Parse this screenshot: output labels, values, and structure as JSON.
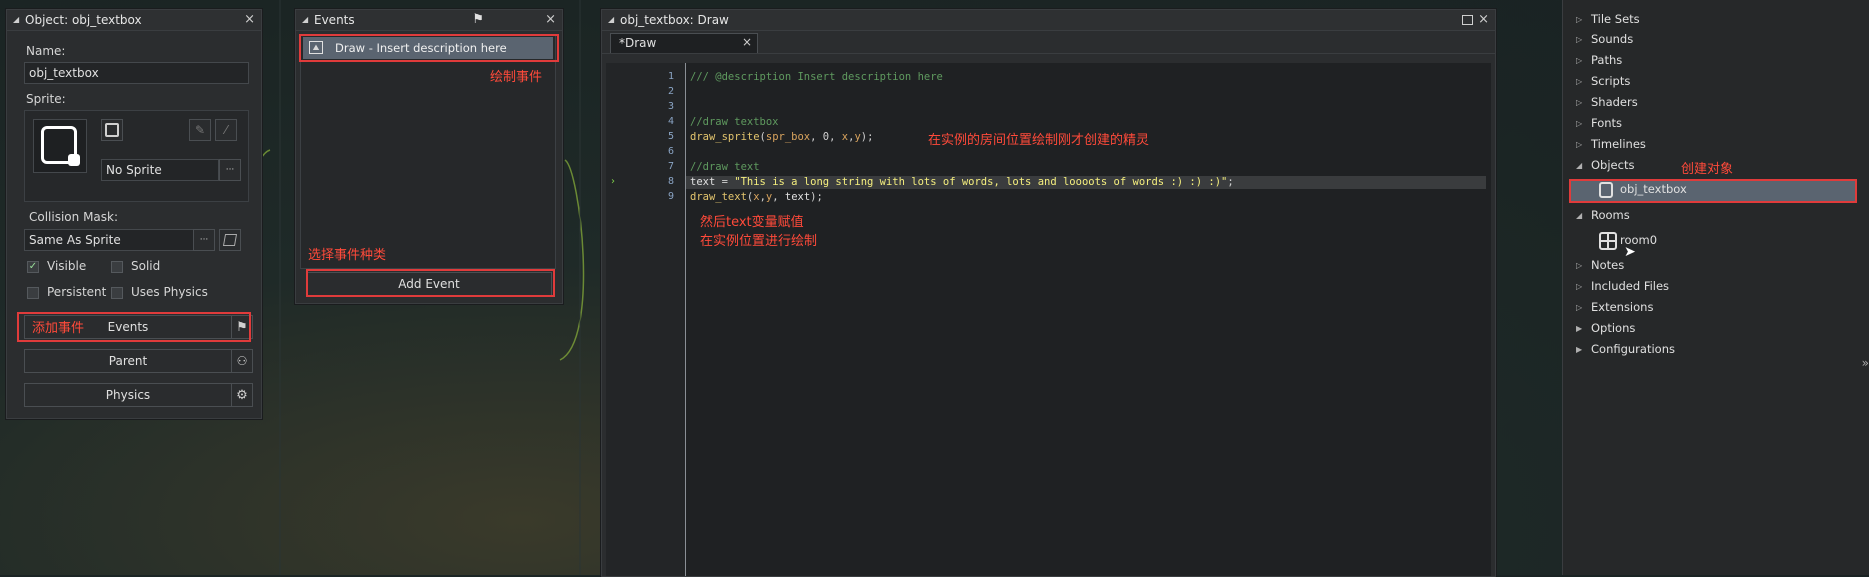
{
  "object_panel": {
    "title": "Object: obj_textbox",
    "name_label": "Name:",
    "name_value": "obj_textbox",
    "sprite_label": "Sprite:",
    "sprite_value": "No Sprite",
    "collision_label": "Collision Mask:",
    "collision_value": "Same As Sprite",
    "visible_label": "Visible",
    "solid_label": "Solid",
    "persistent_label": "Persistent",
    "physics_check_label": "Uses Physics",
    "events_button": "Events",
    "parent_button": "Parent",
    "physics_button": "Physics",
    "ellipsis": "···",
    "visible_checked": true,
    "solid_checked": false,
    "persistent_checked": false,
    "uses_physics_checked": false
  },
  "events_panel": {
    "title": "Events",
    "event_item": "Draw - Insert description here",
    "add_event_button": "Add Event"
  },
  "editor_panel": {
    "title": "obj_textbox: Draw",
    "tab_label": "*Draw",
    "lines": [
      {
        "num": "1",
        "parts": [
          {
            "t": "/// @description Insert description here",
            "c": "#5f9a5f"
          }
        ]
      },
      {
        "num": "2",
        "parts": []
      },
      {
        "num": "3",
        "parts": []
      },
      {
        "num": "4",
        "parts": [
          {
            "t": "//draw textbox",
            "c": "#5f9a5f"
          }
        ]
      },
      {
        "num": "5",
        "parts": [
          {
            "t": "draw_sprite",
            "c": "#e3c56e"
          },
          {
            "t": "(",
            "c": "#d0d0d0"
          },
          {
            "t": "spr_box",
            "c": "#d9a45e"
          },
          {
            "t": ", ",
            "c": "#d0d0d0"
          },
          {
            "t": "0",
            "c": "#d0d0d0"
          },
          {
            "t": ", ",
            "c": "#d0d0d0"
          },
          {
            "t": "x",
            "c": "#d9a45e"
          },
          {
            "t": ",",
            "c": "#d0d0d0"
          },
          {
            "t": "y",
            "c": "#d9a45e"
          },
          {
            "t": ");",
            "c": "#d0d0d0"
          }
        ]
      },
      {
        "num": "6",
        "parts": []
      },
      {
        "num": "7",
        "parts": [
          {
            "t": "//draw text",
            "c": "#5f9a5f"
          }
        ]
      },
      {
        "num": "8",
        "parts": [
          {
            "t": "text",
            "c": "#e0e0e0"
          },
          {
            "t": " = ",
            "c": "#d0d0d0"
          },
          {
            "t": "\"This is a long string with lots of words, lots and loooots of words :) :) :)\"",
            "c": "#f5ef7e"
          },
          {
            "t": ";",
            "c": "#d0d0d0"
          }
        ]
      },
      {
        "num": "9",
        "parts": [
          {
            "t": "draw_text",
            "c": "#e3c56e"
          },
          {
            "t": "(",
            "c": "#d0d0d0"
          },
          {
            "t": "x",
            "c": "#d9a45e"
          },
          {
            "t": ",",
            "c": "#d0d0d0"
          },
          {
            "t": "y",
            "c": "#d9a45e"
          },
          {
            "t": ", ",
            "c": "#d0d0d0"
          },
          {
            "t": "text",
            "c": "#e0e0e0"
          },
          {
            "t": ");",
            "c": "#d0d0d0"
          }
        ]
      }
    ]
  },
  "resource_tree": {
    "items": [
      {
        "label": "Tile Sets",
        "tri": "▷"
      },
      {
        "label": "Sounds",
        "tri": "▷"
      },
      {
        "label": "Paths",
        "tri": "▷"
      },
      {
        "label": "Scripts",
        "tri": "▷"
      },
      {
        "label": "Shaders",
        "tri": "▷"
      },
      {
        "label": "Fonts",
        "tri": "▷"
      },
      {
        "label": "Timelines",
        "tri": "▷"
      },
      {
        "label": "Objects",
        "tri": "◢"
      },
      {
        "label": "obj_textbox",
        "tri": ""
      },
      {
        "label": "Rooms",
        "tri": "◢"
      },
      {
        "label": "room0",
        "tri": ""
      },
      {
        "label": "Notes",
        "tri": "▷"
      },
      {
        "label": "Included Files",
        "tri": "▷"
      },
      {
        "label": "Extensions",
        "tri": "▷"
      },
      {
        "label": "Options",
        "tri": "▶"
      },
      {
        "label": "Configurations",
        "tri": "▶"
      }
    ],
    "side_arrow": "»"
  },
  "annotations": {
    "draw_event": "绘制事件",
    "choose_event_type": "选择事件种类",
    "add_event": "添加事件",
    "draw_sprite_note": "在实例的房间位置绘制刚才创建的精灵",
    "text_note_1": "然后text变量赋值",
    "text_note_2": "在实例位置进行绘制",
    "create_object": "创建对象"
  },
  "colors": {
    "accent_red": "#e03b3b",
    "annotation_red": "#ff4a3a",
    "panel_bg": "#2b2d2f",
    "selection_bg": "#5a6470"
  }
}
